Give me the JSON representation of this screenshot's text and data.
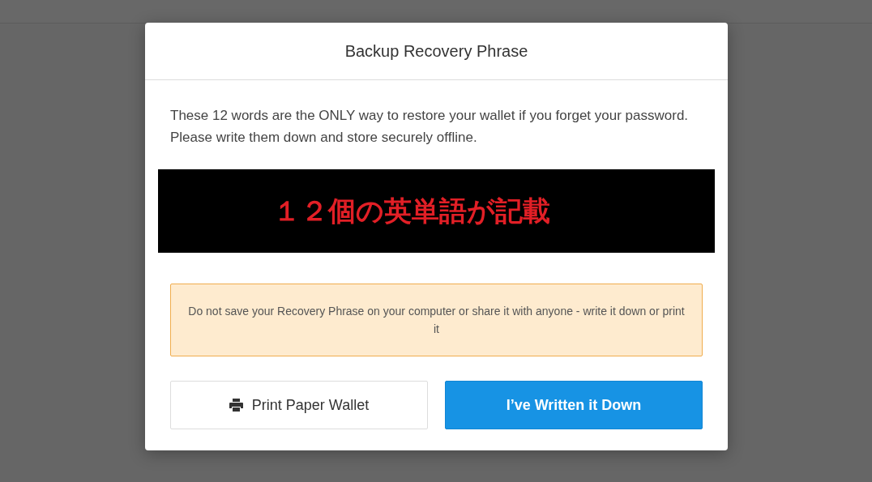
{
  "dialog": {
    "title": "Backup Recovery Phrase",
    "intro": "These 12 words are the ONLY way to restore your wallet if you forget your password. Please write them down and store securely offline.",
    "phrase_cover": "１２個の英単語が記載",
    "warning": "Do not save your Recovery Phrase on your computer or share it with anyone - write it down or print it",
    "buttons": [
      {
        "label": "Print Paper Wallet",
        "kind": "secondary"
      },
      {
        "label": "I’ve Written it Down",
        "kind": "primary"
      }
    ]
  }
}
